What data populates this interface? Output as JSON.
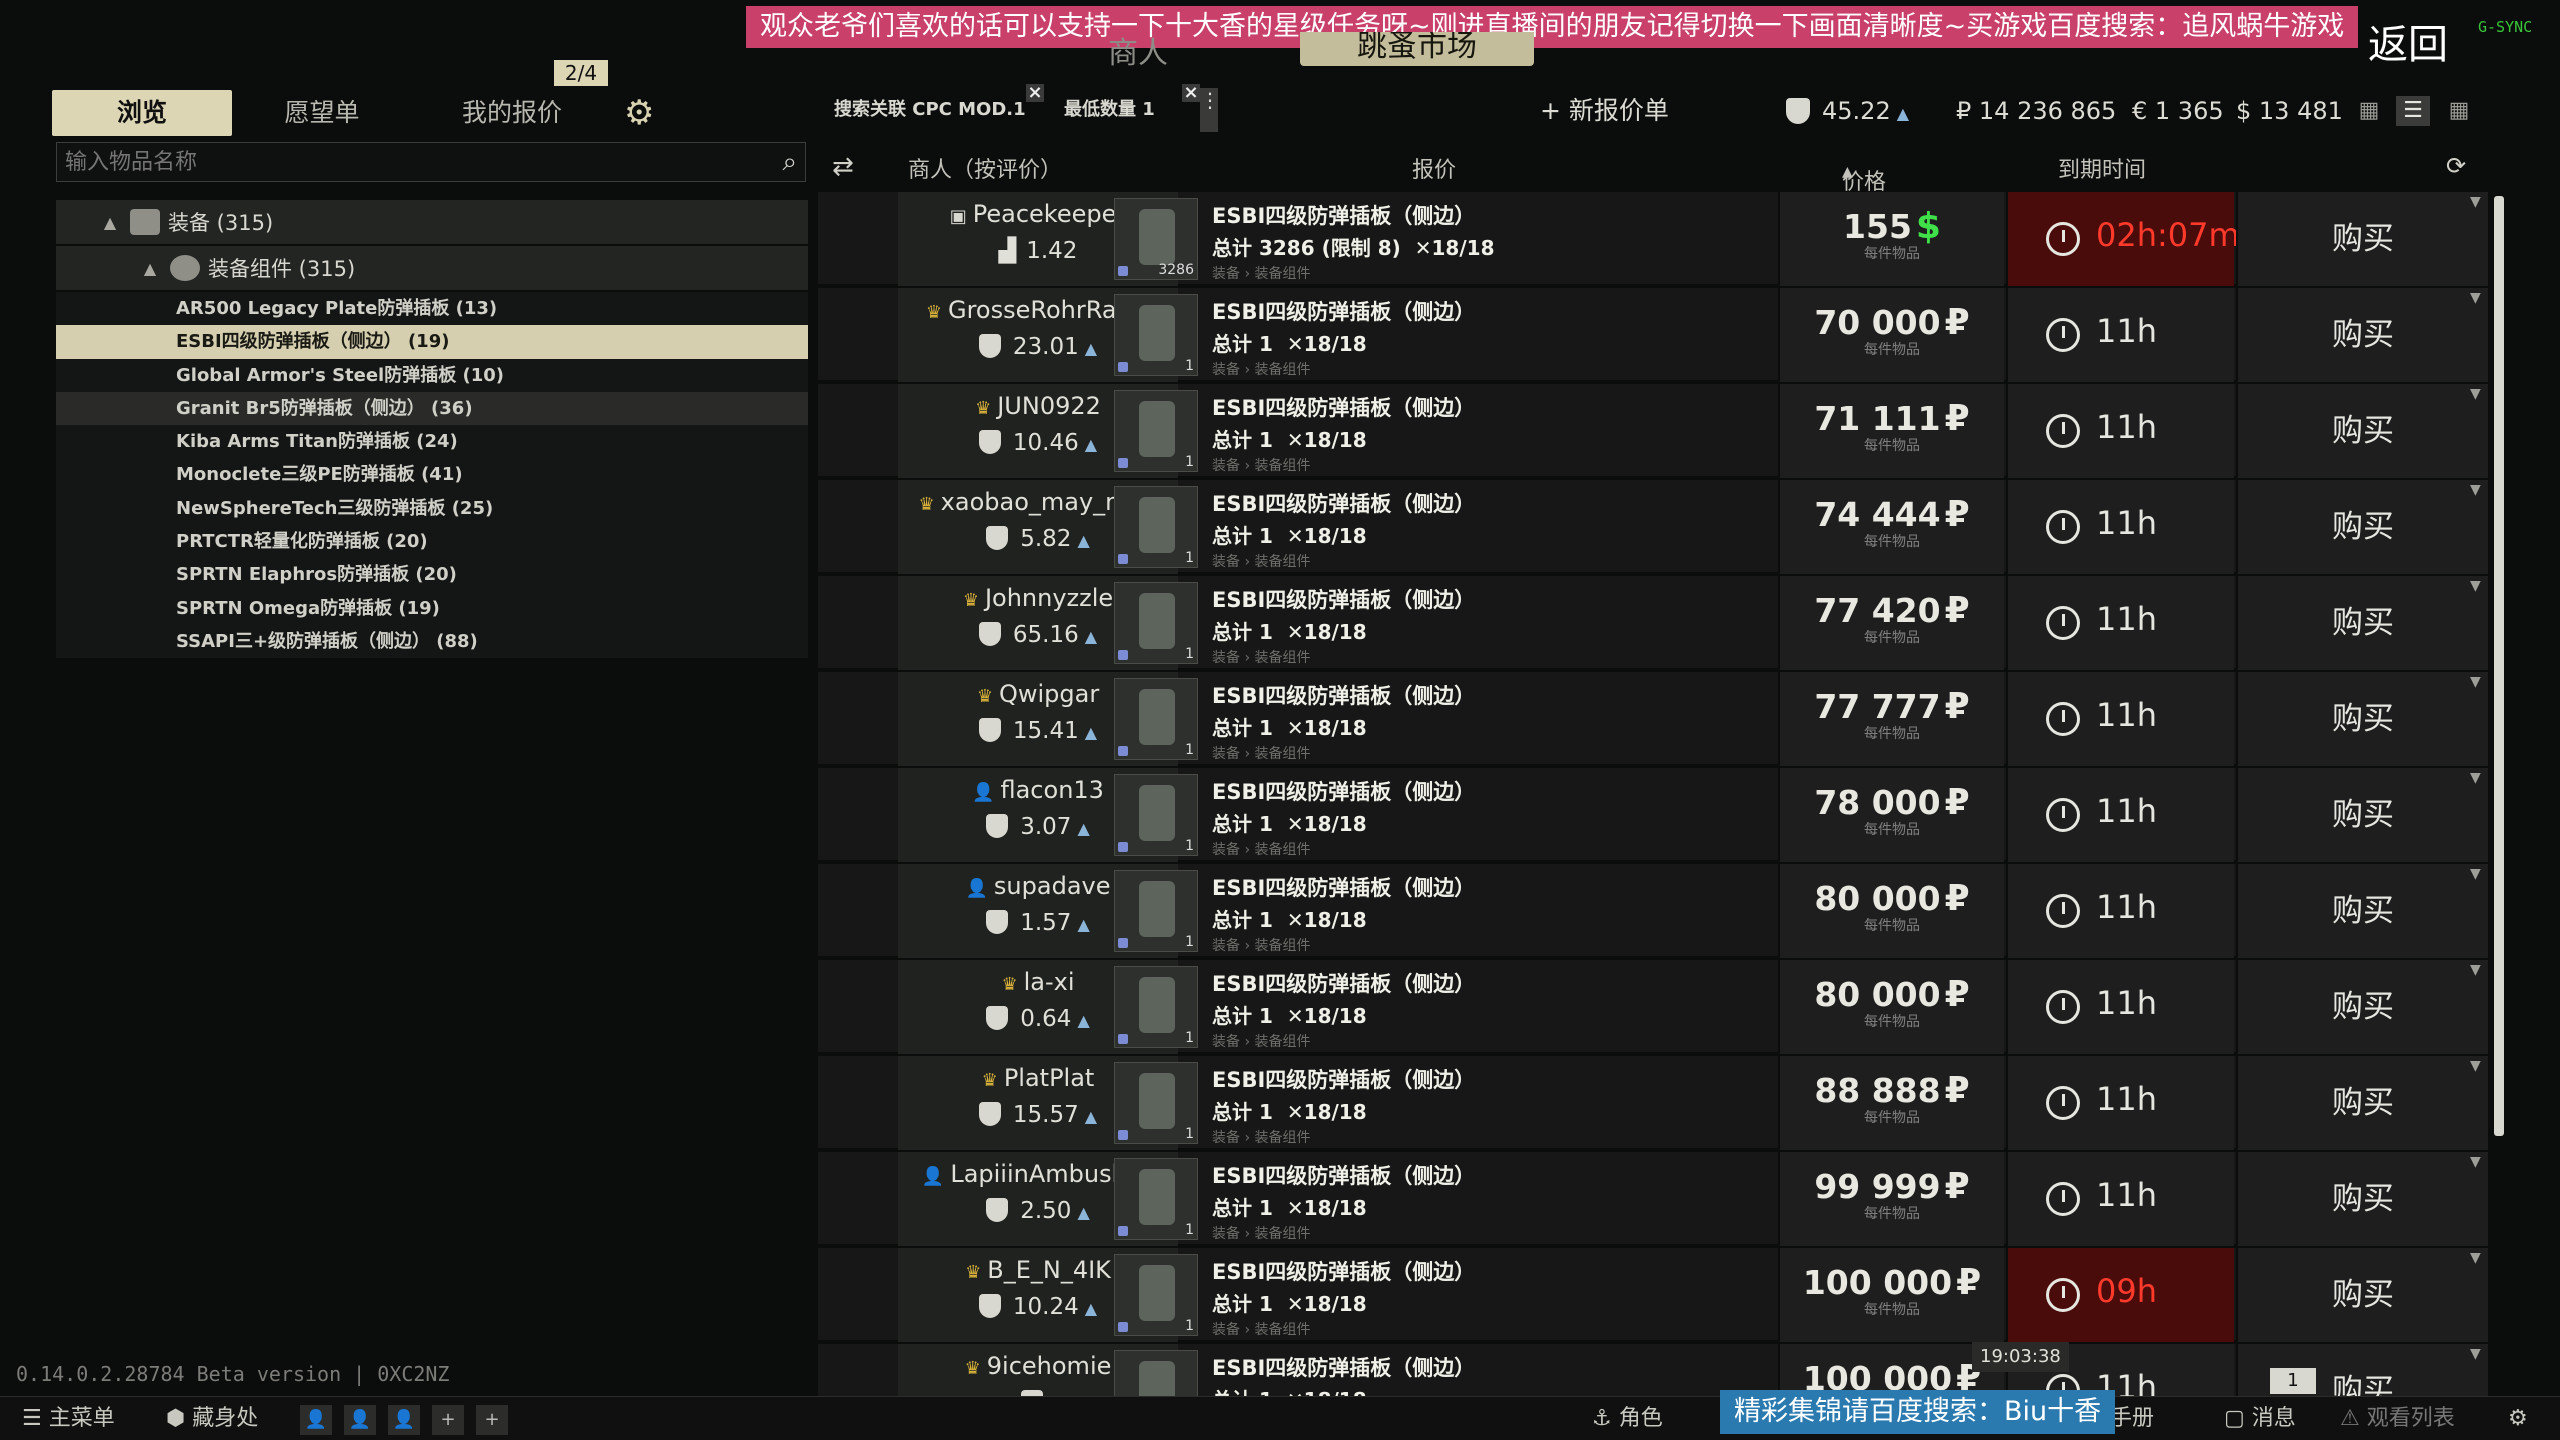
{
  "overlay": {
    "top_banner": "观众老爷们喜欢的话可以支持一下十大香的星级任务呀~刚进直播间的朋友记得切换一下画面清晰度~买游戏百度搜索：追风蜗牛游戏",
    "bottom_banner": "精彩集锦请百度搜索：Biu十香",
    "gsync": "G-SYNC"
  },
  "header": {
    "back_label": "返回",
    "traders_tab": "商人",
    "flea_tab": "跳蚤市场"
  },
  "left": {
    "tabs": [
      "浏览",
      "愿望单",
      "我的报价"
    ],
    "offer_badge": "2/4",
    "search_placeholder": "输入物品名称",
    "tree": [
      {
        "label": "装备 (315)"
      },
      {
        "label": "装备组件 (315)"
      }
    ],
    "items": [
      "AR500 Legacy Plate防弹插板 (13)",
      "ESBI四级防弹插板（侧边） (19)",
      "Global Armor's Steel防弹插板 (10)",
      "Granit Br5防弹插板（侧边） (36)",
      "Kiba Arms Titan防弹插板 (24)",
      "Monoclete三级PE防弹插板 (41)",
      "NewSphereTech三级防弹插板 (25)",
      "PRTCTR轻量化防弹插板 (20)",
      "SPRTN Elaphros防弹插板 (20)",
      "SPRTN Omega防弹插板 (19)",
      "SSAPI三+级防弹插板（侧边） (88)"
    ],
    "selected_index": 1
  },
  "filters": {
    "chips": [
      "搜索关联 CPC MOD.1",
      "最低数量 1"
    ],
    "new_offer": "+ 新报价单",
    "rating": "45.22",
    "roubles": "₽ 14 236 865",
    "euros": "€ 1 365",
    "dollars": "$ 13 481"
  },
  "columns": {
    "seller": "商人（按评价）",
    "offer": "报价",
    "price": "价格",
    "expires": "到期时间"
  },
  "item": {
    "name": "ESBI四级防弹插板（侧边）",
    "path": "装备 › 装备组件",
    "per_item": "每件物品",
    "buy": "购买"
  },
  "offers": [
    {
      "seller": "Peacekeeper",
      "trader": true,
      "rating": "1.42",
      "qty": "总计 3286 (限制 8)",
      "cond": "18/18",
      "stack": "3286",
      "price": "155",
      "currency": "$",
      "ttl": "02h:07m",
      "urgent": true
    },
    {
      "seller": "GrosseRohrRatte",
      "crown": true,
      "rating": "23.01",
      "qty": "总计 1",
      "cond": "18/18",
      "stack": "1",
      "price": "70 000",
      "currency": "₽",
      "ttl": "11h",
      "urgent": false
    },
    {
      "seller": "JUN0922",
      "crown": true,
      "rating": "10.46",
      "qty": "总计 1",
      "cond": "18/18",
      "stack": "1",
      "price": "71 111",
      "currency": "₽",
      "ttl": "11h",
      "urgent": false
    },
    {
      "seller": "xaobao_may_may",
      "crown": true,
      "rating": "5.82",
      "qty": "总计 1",
      "cond": "18/18",
      "stack": "1",
      "price": "74 444",
      "currency": "₽",
      "ttl": "11h",
      "urgent": false
    },
    {
      "seller": "Johnnyzzle",
      "crown": true,
      "rating": "65.16",
      "qty": "总计 1",
      "cond": "18/18",
      "stack": "1",
      "price": "77 420",
      "currency": "₽",
      "ttl": "11h",
      "urgent": false
    },
    {
      "seller": "Qwipgar",
      "crown": true,
      "rating": "15.41",
      "qty": "总计 1",
      "cond": "18/18",
      "stack": "1",
      "price": "77 777",
      "currency": "₽",
      "ttl": "11h",
      "urgent": false
    },
    {
      "seller": "flacon13",
      "crown": false,
      "rating": "3.07",
      "qty": "总计 1",
      "cond": "18/18",
      "stack": "1",
      "price": "78 000",
      "currency": "₽",
      "ttl": "11h",
      "urgent": false
    },
    {
      "seller": "supadave",
      "crown": false,
      "rating": "1.57",
      "qty": "总计 1",
      "cond": "18/18",
      "stack": "1",
      "price": "80 000",
      "currency": "₽",
      "ttl": "11h",
      "urgent": false
    },
    {
      "seller": "la-xi",
      "crown": true,
      "rating": "0.64",
      "qty": "总计 1",
      "cond": "18/18",
      "stack": "1",
      "price": "80 000",
      "currency": "₽",
      "ttl": "11h",
      "urgent": false
    },
    {
      "seller": "PlatPlat",
      "crown": true,
      "rating": "15.57",
      "qty": "总计 1",
      "cond": "18/18",
      "stack": "1",
      "price": "88 888",
      "currency": "₽",
      "ttl": "11h",
      "urgent": false
    },
    {
      "seller": "LapiiinAmbushes",
      "crown": false,
      "rating": "2.50",
      "qty": "总计 1",
      "cond": "18/18",
      "stack": "1",
      "price": "99 999",
      "currency": "₽",
      "ttl": "11h",
      "urgent": false
    },
    {
      "seller": "B_E_N_4IK",
      "crown": true,
      "rating": "10.24",
      "qty": "总计 1",
      "cond": "18/18",
      "stack": "1",
      "price": "100 000",
      "currency": "₽",
      "ttl": "09h",
      "urgent": true
    },
    {
      "seller": "9icehomie",
      "crown": true,
      "rating": "",
      "qty": "总计 1",
      "cond": "18/18",
      "stack": "1",
      "price": "100 000",
      "currency": "₽",
      "ttl": "11h",
      "urgent": false
    }
  ],
  "footer": {
    "version": "0.14.0.2.28784 Beta version | 0XC2NZ",
    "time_tip": "19:03:38",
    "pen_badge": "1",
    "main_menu": "主菜单",
    "hideout": "藏身处",
    "character": "角色",
    "handbook": "手册",
    "messages": "消息",
    "watchlist": "观看列表"
  }
}
